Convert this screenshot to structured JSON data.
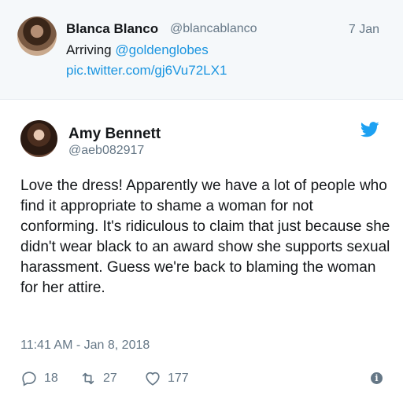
{
  "parent_tweet": {
    "name": "Blanca Blanco",
    "handle": "@blancablanco",
    "date": "7 Jan",
    "text_prefix": "Arriving ",
    "mention": "@goldenglobes",
    "link": "pic.twitter.com/gj6Vu72LX1"
  },
  "tweet": {
    "name": "Amy Bennett",
    "handle": "@aeb082917",
    "text": "Love the dress! Apparently we have a lot of people who find it appropriate to shame a woman for not conforming. It's ridiculous to claim that just because she didn't wear black to an award show she supports sexual harassment. Guess we're back to blaming the woman for her attire.",
    "timestamp": "11:41 AM - Jan 8, 2018",
    "reply_count": "18",
    "retweet_count": "27",
    "like_count": "177"
  },
  "colors": {
    "link": "#1b95e0",
    "muted": "#657786",
    "text": "#14171a",
    "twitter_blue": "#1da1f2",
    "parent_bg": "#f5f8fa"
  },
  "icons": [
    "twitter-bird-icon",
    "reply-icon",
    "retweet-icon",
    "like-icon",
    "info-icon"
  ]
}
